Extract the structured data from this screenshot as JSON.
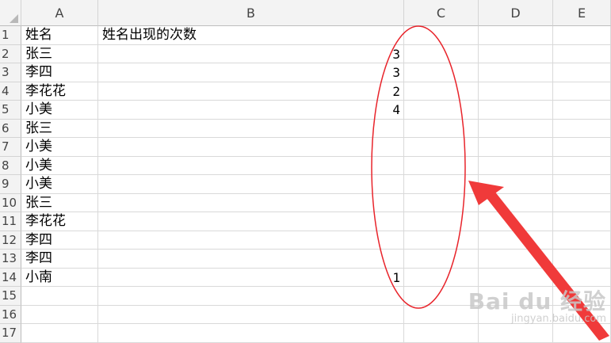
{
  "sheet": {
    "columns": [
      "A",
      "B",
      "C",
      "D",
      "E"
    ],
    "rows": [
      {
        "num": "1",
        "a": "姓名",
        "b": "姓名出现的次数"
      },
      {
        "num": "2",
        "a": "张三",
        "b": "3"
      },
      {
        "num": "3",
        "a": "李四",
        "b": "3"
      },
      {
        "num": "4",
        "a": "李花花",
        "b": "2"
      },
      {
        "num": "5",
        "a": "小美",
        "b": "4"
      },
      {
        "num": "6",
        "a": "张三",
        "b": ""
      },
      {
        "num": "7",
        "a": "小美",
        "b": ""
      },
      {
        "num": "8",
        "a": "小美",
        "b": ""
      },
      {
        "num": "9",
        "a": "小美",
        "b": ""
      },
      {
        "num": "10",
        "a": "张三",
        "b": ""
      },
      {
        "num": "11",
        "a": "李花花",
        "b": ""
      },
      {
        "num": "12",
        "a": "李四",
        "b": ""
      },
      {
        "num": "13",
        "a": "李四",
        "b": ""
      },
      {
        "num": "14",
        "a": "小南",
        "b": "1"
      },
      {
        "num": "15",
        "a": "",
        "b": ""
      },
      {
        "num": "16",
        "a": "",
        "b": ""
      },
      {
        "num": "17",
        "a": "",
        "b": ""
      }
    ]
  },
  "annotation": {
    "ellipse_color": "#e8242b",
    "arrow_color": "#f03a3a"
  },
  "watermark": {
    "line1": "Bai du 经验",
    "line2": "jingyan.baidu.com"
  }
}
